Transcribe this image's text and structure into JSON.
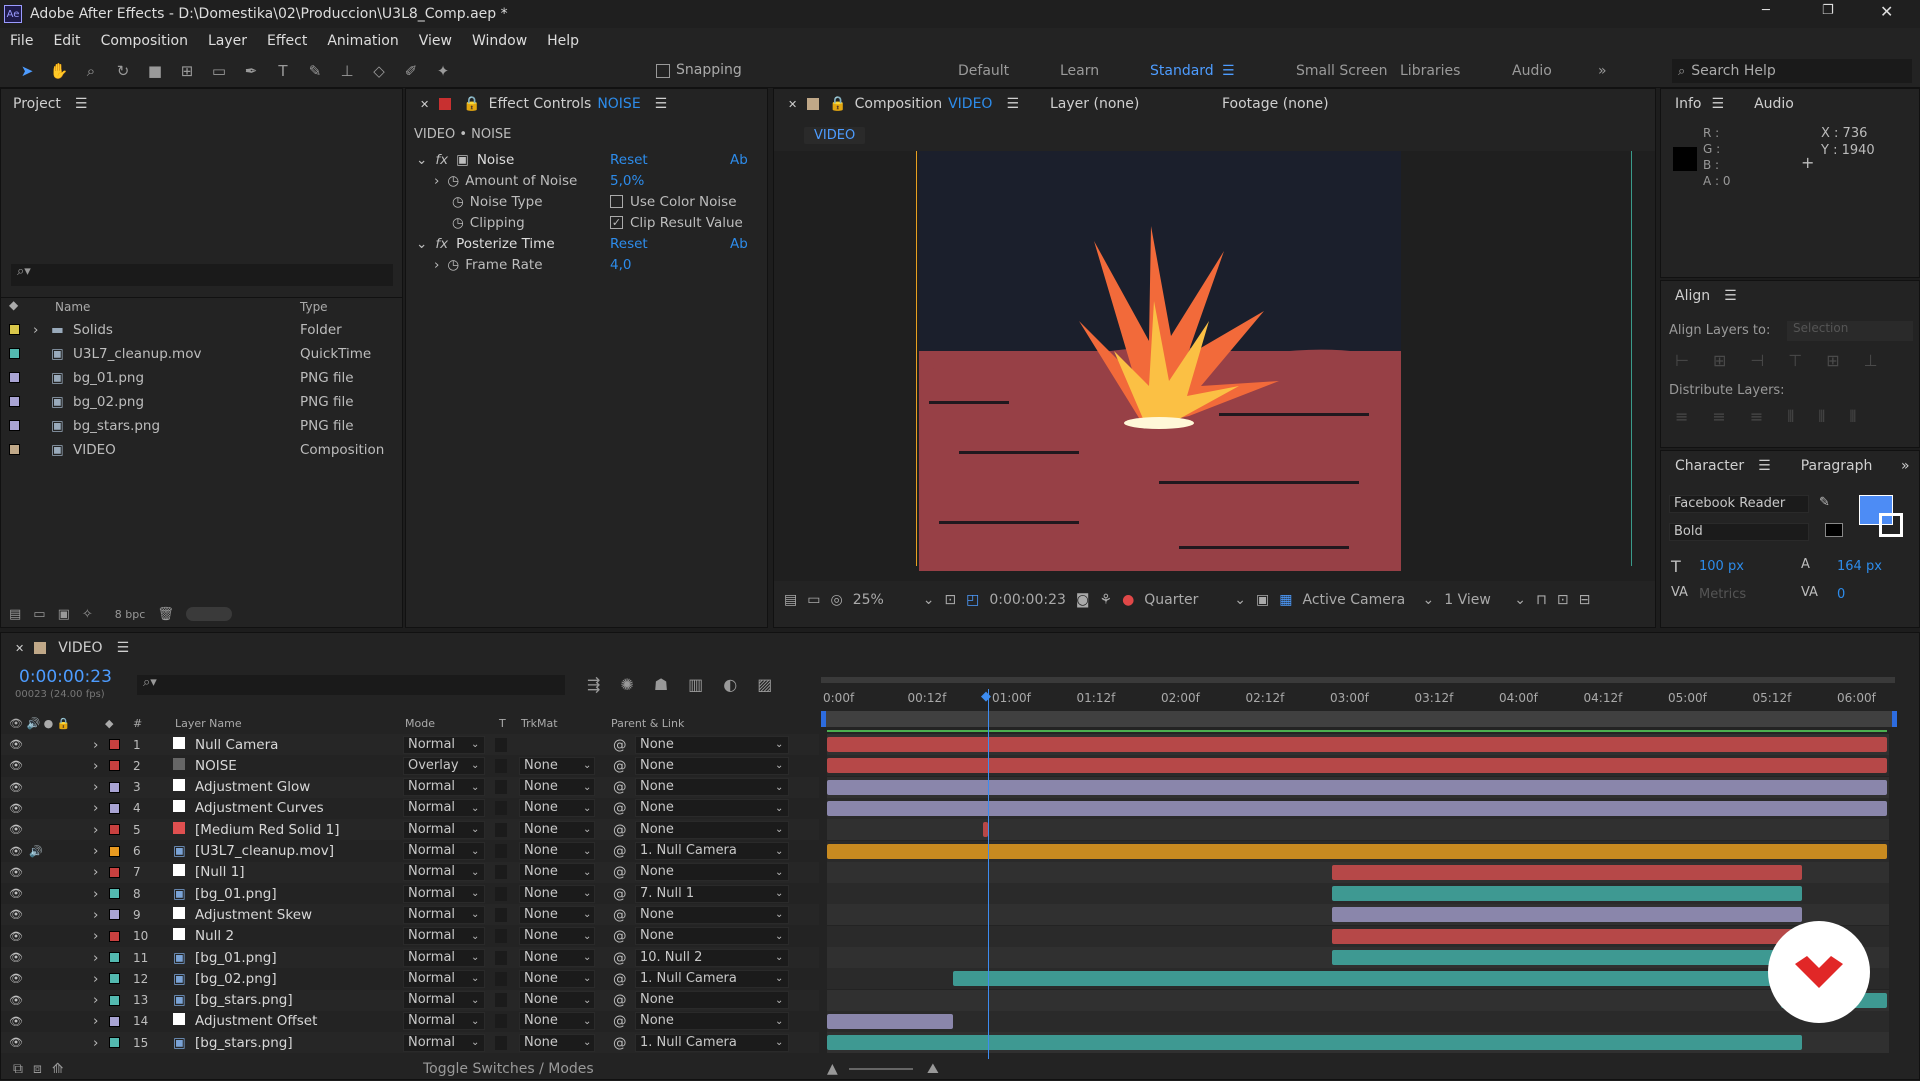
{
  "window": {
    "title": "Adobe After Effects - D:\\Domestika\\02\\Produccion\\U3L8_Comp.aep *",
    "app_icon": "Ae"
  },
  "menu": [
    "File",
    "Edit",
    "Composition",
    "Layer",
    "Effect",
    "Animation",
    "View",
    "Window",
    "Help"
  ],
  "toolbar": {
    "snapping": "Snapping",
    "search_placeholder": "Search Help",
    "workspaces": [
      "Default",
      "Learn",
      "Standard",
      "Small Screen",
      "Libraries",
      "Audio"
    ],
    "active_workspace": "Standard"
  },
  "project": {
    "title": "Project",
    "cols": {
      "name": "Name",
      "type": "Type"
    },
    "items": [
      {
        "name": "Solids",
        "type": "Folder",
        "color": "#d9c74a"
      },
      {
        "name": "U3L7_cleanup.mov",
        "type": "QuickTime",
        "color": "#53b9b0"
      },
      {
        "name": "bg_01.png",
        "type": "PNG file",
        "color": "#a9a4d4"
      },
      {
        "name": "bg_02.png",
        "type": "PNG file",
        "color": "#a9a4d4"
      },
      {
        "name": "bg_stars.png",
        "type": "PNG file",
        "color": "#a9a4d4"
      },
      {
        "name": "VIDEO",
        "type": "Composition",
        "color": "#c0a888"
      }
    ],
    "bpc": "8 bpc"
  },
  "effects": {
    "tab_prefix": "Effect Controls",
    "tab_layer": "NOISE",
    "header": "VIDEO • NOISE",
    "reset": "Reset",
    "ab": "Ab",
    "noise": {
      "name": "Noise",
      "amount_label": "Amount of Noise",
      "amount": "5,0%",
      "type_label": "Noise Type",
      "type_value": "Use Color Noise",
      "clip_label": "Clipping",
      "clip_value": "Clip Result Value"
    },
    "posterize": {
      "name": "Posterize Time",
      "rate_label": "Frame Rate",
      "rate": "4,0"
    }
  },
  "viewer": {
    "comp_tab_prefix": "Composition",
    "comp_name": "VIDEO",
    "layer_tab": "Layer (none)",
    "footage_tab": "Footage (none)",
    "breadcrumb": "VIDEO",
    "zoom": "25%",
    "timecode": "0:00:00:23",
    "resolution": "Quarter",
    "camera": "Active Camera",
    "views": "1 View"
  },
  "info": {
    "tab": "Info",
    "tab2": "Audio",
    "r": "R :",
    "g": "G :",
    "b": "B :",
    "a": "A : 0",
    "x": "X : 736",
    "y": "Y : 1940"
  },
  "align": {
    "title": "Align",
    "align_to": "Align Layers to:",
    "selection": "Selection",
    "distribute": "Distribute Layers:"
  },
  "character": {
    "tab": "Character",
    "tab2": "Paragraph",
    "font": "Facebook Reader",
    "style": "Bold",
    "size": "100 px",
    "leading": "164 px",
    "kerning": "Metrics",
    "tracking": "0",
    "fill": "#4d8cf5"
  },
  "timeline": {
    "comp": "VIDEO",
    "timecode": "0:00:00:23",
    "fps": "00023 (24.00 fps)",
    "cols": {
      "name": "Layer Name",
      "mode": "Mode",
      "t": "T",
      "trkmat": "TrkMat",
      "parent": "Parent & Link"
    },
    "ticks": [
      "0:00f",
      "00:12f",
      "01:00f",
      "01:12f",
      "02:00f",
      "02:12f",
      "03:00f",
      "03:12f",
      "04:00f",
      "04:12f",
      "05:00f",
      "05:12f",
      "06:00f"
    ],
    "toggle": "Toggle Switches / Modes",
    "layers": [
      {
        "n": "1",
        "name": "Null Camera",
        "mode": "Normal",
        "trk": "",
        "parent": "None",
        "label": "#c8403f",
        "icon": "white",
        "bar": [
          0,
          1
        ],
        "barc": "#b64848"
      },
      {
        "n": "2",
        "name": "NOISE",
        "mode": "Overlay",
        "trk": "None",
        "parent": "None",
        "label": "#c8403f",
        "icon": "gray",
        "bar": [
          0,
          1
        ],
        "barc": "#b64848"
      },
      {
        "n": "3",
        "name": "Adjustment Glow",
        "mode": "Normal",
        "trk": "None",
        "parent": "None",
        "label": "#a9a4d4",
        "icon": "white",
        "bar": [
          0,
          1
        ],
        "barc": "#8a86ab"
      },
      {
        "n": "4",
        "name": "Adjustment Curves",
        "mode": "Normal",
        "trk": "None",
        "parent": "None",
        "label": "#a9a4d4",
        "icon": "white",
        "bar": [
          0,
          1
        ],
        "barc": "#8a86ab"
      },
      {
        "n": "5",
        "name": "[Medium Red Solid 1]",
        "mode": "Normal",
        "trk": "None",
        "parent": "None",
        "label": "#c8403f",
        "icon": "red",
        "bar": [
          0.147,
          0.152
        ],
        "barc": "#b64848"
      },
      {
        "n": "6",
        "name": "[U3L7_cleanup.mov]",
        "mode": "Normal",
        "trk": "None",
        "parent": "1. Null Camera",
        "label": "#e89a20",
        "icon": "file",
        "bar": [
          0,
          1
        ],
        "barc": "#c88a20"
      },
      {
        "n": "7",
        "name": "[Null 1]",
        "mode": "Normal",
        "trk": "None",
        "parent": "None",
        "label": "#c8403f",
        "icon": "white",
        "bar": [
          0.476,
          0.92
        ],
        "barc": "#b64848"
      },
      {
        "n": "8",
        "name": "[bg_01.png]",
        "mode": "Normal",
        "trk": "None",
        "parent": "7. Null 1",
        "label": "#53b9b0",
        "icon": "file",
        "bar": [
          0.476,
          0.92
        ],
        "barc": "#3e9992"
      },
      {
        "n": "9",
        "name": "Adjustment Skew",
        "mode": "Normal",
        "trk": "None",
        "parent": "None",
        "label": "#a9a4d4",
        "icon": "white",
        "bar": [
          0.476,
          0.92
        ],
        "barc": "#8a86ab"
      },
      {
        "n": "10",
        "name": "Null 2",
        "mode": "Normal",
        "trk": "None",
        "parent": "None",
        "label": "#c8403f",
        "icon": "white",
        "bar": [
          0.476,
          0.92
        ],
        "barc": "#b64848"
      },
      {
        "n": "11",
        "name": "[bg_01.png]",
        "mode": "Normal",
        "trk": "None",
        "parent": "10. Null 2",
        "label": "#53b9b0",
        "icon": "file",
        "bar": [
          0.476,
          0.92
        ],
        "barc": "#3e9992"
      },
      {
        "n": "12",
        "name": "[bg_02.png]",
        "mode": "Normal",
        "trk": "None",
        "parent": "1. Null Camera",
        "label": "#53b9b0",
        "icon": "file",
        "bar": [
          0.119,
          0.92
        ],
        "barc": "#3e9992"
      },
      {
        "n": "13",
        "name": "[bg_stars.png]",
        "mode": "Normal",
        "trk": "None",
        "parent": "None",
        "label": "#53b9b0",
        "icon": "file",
        "bar": [
          0.9,
          1
        ],
        "barc": "#3e9992"
      },
      {
        "n": "14",
        "name": "Adjustment Offset",
        "mode": "Normal",
        "trk": "None",
        "parent": "None",
        "label": "#a9a4d4",
        "icon": "white",
        "bar": [
          0,
          0.119
        ],
        "barc": "#8a86ab"
      },
      {
        "n": "15",
        "name": "[bg_stars.png]",
        "mode": "Normal",
        "trk": "None",
        "parent": "1. Null Camera",
        "label": "#53b9b0",
        "icon": "file",
        "bar": [
          0,
          0.92
        ],
        "barc": "#3e9992"
      }
    ]
  }
}
